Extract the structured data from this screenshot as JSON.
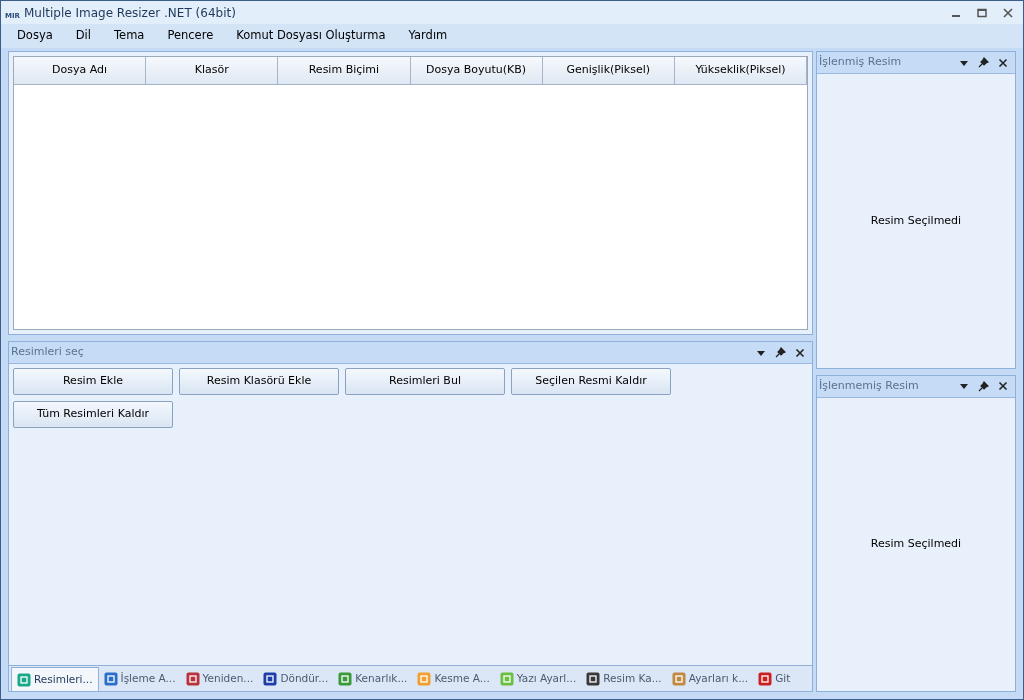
{
  "window": {
    "title": "Multiple Image Resizer .NET (64bit)",
    "logo": "MIR"
  },
  "menu": [
    "Dosya",
    "Dil",
    "Tema",
    "Pencere",
    "Komut Dosyası Oluşturma",
    "Yardım"
  ],
  "table": {
    "columns": [
      "Dosya Adı",
      "Klasör",
      "Resim Biçimi",
      "Dosya Boyutu(KB)",
      "Genişlik(Piksel)",
      "Yükseklik(Piksel)"
    ]
  },
  "select_panel": {
    "title": "Resimleri seç",
    "buttons": [
      "Resim Ekle",
      "Resim Klasörü Ekle",
      "Resimleri Bul",
      "Seçilen Resmi Kaldır",
      "Tüm Resimleri Kaldır"
    ]
  },
  "processed_panel": {
    "title": "İşlenmiş Resim",
    "message": "Resim Seçilmedi"
  },
  "unprocessed_panel": {
    "title": "İşlenmemiş Resim",
    "message": "Resim Seçilmedi"
  },
  "tabs": [
    {
      "label": "Resimleri...",
      "selected": true,
      "color": "#1aa88a"
    },
    {
      "label": "İşleme A...",
      "selected": false,
      "color": "#2a6fc9"
    },
    {
      "label": "Yeniden...",
      "selected": false,
      "color": "#b8333a"
    },
    {
      "label": "Döndür...",
      "selected": false,
      "color": "#1f3fa8"
    },
    {
      "label": "Kenarlık...",
      "selected": false,
      "color": "#3a9a3a"
    },
    {
      "label": "Kesme A...",
      "selected": false,
      "color": "#f0a030"
    },
    {
      "label": "Yazı Ayarl...",
      "selected": false,
      "color": "#6cc040"
    },
    {
      "label": "Resim Ka...",
      "selected": false,
      "color": "#3a3a3a"
    },
    {
      "label": "Ayarları k...",
      "selected": false,
      "color": "#c08a40"
    },
    {
      "label": "Git",
      "selected": false,
      "color": "#cc2020"
    }
  ]
}
